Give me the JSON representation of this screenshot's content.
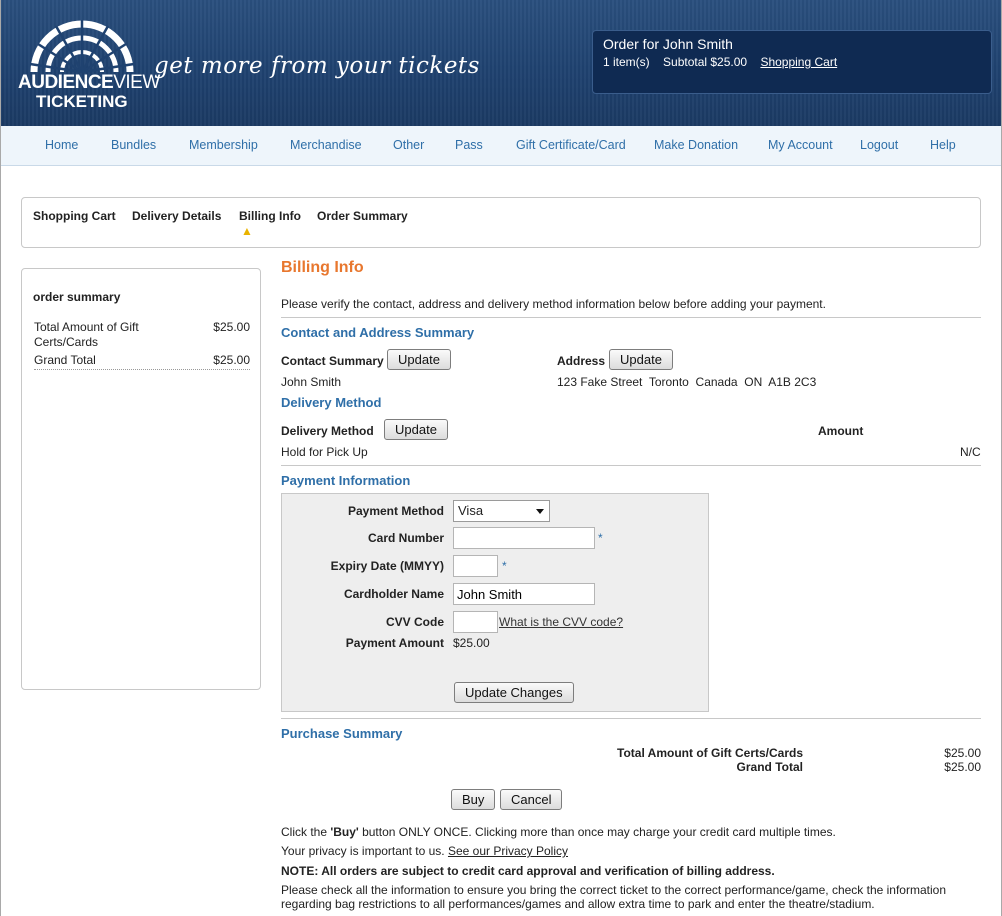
{
  "header": {
    "logo_bold": "AUDIENCE",
    "logo_thin": "VIEW",
    "logo_line2": "TICKETING",
    "tagline": "get more from your tickets",
    "cart": {
      "title": "Order for John Smith",
      "items": "1 item(s)",
      "subtotal": "Subtotal $25.00",
      "cart_link": "Shopping Cart"
    }
  },
  "nav": {
    "items": [
      "Home",
      "Bundles",
      "Membership",
      "Merchandise",
      "Other",
      "Pass",
      "Gift Certificate/Card",
      "Make Donation",
      "My Account",
      "Logout",
      "Help"
    ]
  },
  "steps": {
    "items": [
      "Shopping Cart",
      "Delivery Details",
      "Billing Info",
      "Order Summary"
    ],
    "current_index": 2
  },
  "sidebar": {
    "title": "order summary",
    "rows": [
      {
        "label": "Total Amount of Gift Certs/Cards",
        "value": "$25.00"
      },
      {
        "label": "Grand Total",
        "value": "$25.00"
      }
    ]
  },
  "page": {
    "title": "Billing Info",
    "intro": "Please verify the contact, address and delivery method information below before adding your payment."
  },
  "contact": {
    "heading": "Contact and Address Summary",
    "contact_label": "Contact Summary",
    "contact_value": "John  Smith",
    "address_label": "Address",
    "address_value": "123 Fake Street  Toronto  Canada  ON  A1B 2C3",
    "update_label": "Update"
  },
  "delivery": {
    "heading": "Delivery Method",
    "label": "Delivery Method",
    "amount_label": "Amount",
    "value": "Hold for Pick Up",
    "amount": "N/C",
    "update_label": "Update"
  },
  "payment": {
    "heading": "Payment Information",
    "method_label": "Payment Method",
    "method_value": "Visa",
    "card_label": "Card Number",
    "card_value": "",
    "expiry_label": "Expiry Date (MMYY)",
    "expiry_value": "",
    "holder_label": "Cardholder Name",
    "holder_value": "John Smith",
    "cvv_label": "CVV Code",
    "cvv_value": "",
    "cvv_link": "What is the CVV code?",
    "amount_label": "Payment Amount",
    "amount_value": "$25.00",
    "required_mark": "*",
    "update_changes": "Update Changes"
  },
  "purchase": {
    "heading": "Purchase Summary",
    "rows": [
      {
        "label": "Total Amount of Gift Certs/Cards",
        "value": "$25.00"
      },
      {
        "label": "Grand Total",
        "value": "$25.00"
      }
    ],
    "buy": "Buy",
    "cancel": "Cancel"
  },
  "footer": {
    "once_pre": "Click the ",
    "once_bold": "'Buy'",
    "once_post": " button ONLY ONCE. Clicking more than once may charge your credit card multiple times.",
    "privacy_text": "Your privacy is important to us. ",
    "privacy_link": "See our Privacy Policy",
    "note": "NOTE: All orders are subject to credit card approval and verification of billing address.",
    "check": "Please check all the information to ensure you bring the correct ticket to the correct performance/game, check the information regarding bag restrictions to all performances/games and allow extra time to park and enter the theatre/stadium."
  },
  "colors": {
    "header_bg": "#1f4270",
    "accent_orange": "#e8772e",
    "link_blue": "#2f6fa8",
    "cart_bg": "#0f2a52"
  }
}
